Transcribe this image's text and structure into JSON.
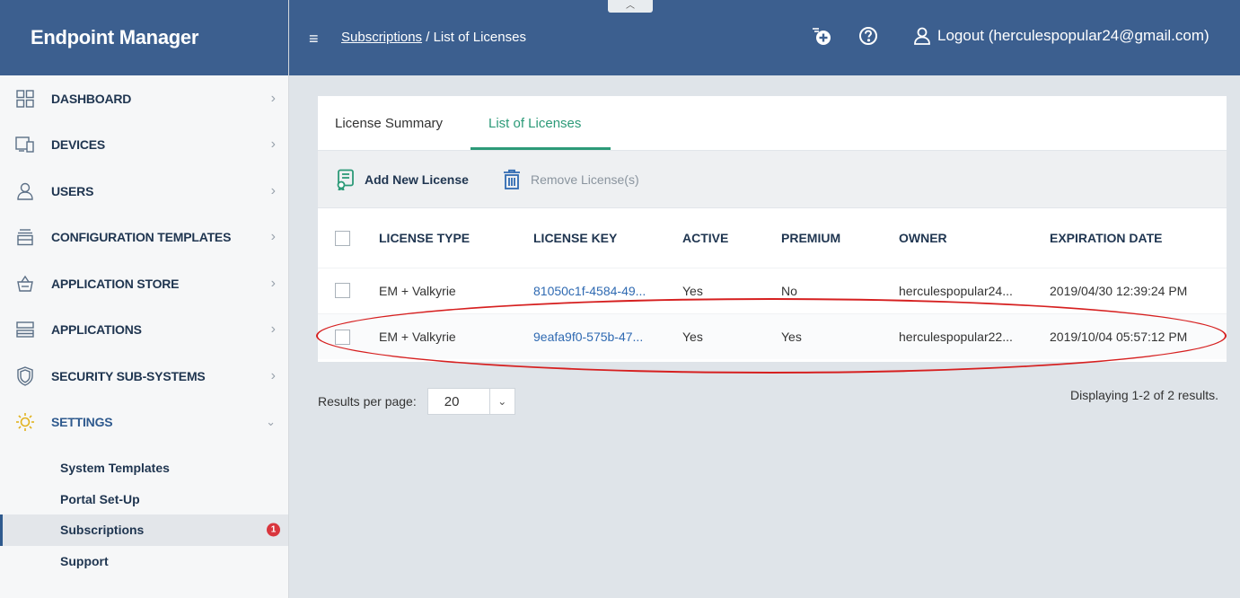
{
  "app": {
    "title": "Endpoint Manager"
  },
  "sidebar": {
    "items": [
      {
        "label": "DASHBOARD",
        "icon": "dashboard-icon"
      },
      {
        "label": "DEVICES",
        "icon": "devices-icon"
      },
      {
        "label": "USERS",
        "icon": "user-icon"
      },
      {
        "label": "CONFIGURATION TEMPLATES",
        "icon": "templates-icon"
      },
      {
        "label": "APPLICATION STORE",
        "icon": "store-basket-icon"
      },
      {
        "label": "APPLICATIONS",
        "icon": "applications-icon"
      },
      {
        "label": "SECURITY SUB-SYSTEMS",
        "icon": "shield-icon"
      },
      {
        "label": "SETTINGS",
        "icon": "gear-icon"
      }
    ],
    "settings_sub": [
      {
        "label": "System Templates"
      },
      {
        "label": "Portal Set-Up"
      },
      {
        "label": "Subscriptions",
        "badge": "1"
      },
      {
        "label": "Support"
      }
    ]
  },
  "header": {
    "breadcrumb_link": "Subscriptions",
    "breadcrumb_sep": " / ",
    "breadcrumb_current": "List of Licenses",
    "logout_label": "Logout (herculespopular24@gmail.com)"
  },
  "tabs": [
    "License Summary",
    "List of Licenses"
  ],
  "toolbar": {
    "add_label": "Add New License",
    "remove_label": "Remove License(s)"
  },
  "table": {
    "headers": [
      "LICENSE TYPE",
      "LICENSE KEY",
      "ACTIVE",
      "PREMIUM",
      "OWNER",
      "EXPIRATION DATE"
    ],
    "rows": [
      [
        "EM + Valkyrie",
        "81050c1f-4584-49...",
        "Yes",
        "No",
        "herculespopular24...",
        "2019/04/30 12:39:24 PM"
      ],
      [
        "EM + Valkyrie",
        "9eafa9f0-575b-47...",
        "Yes",
        "Yes",
        "herculespopular22...",
        "2019/10/04 05:57:12 PM"
      ]
    ]
  },
  "pagination": {
    "results_label": "Results per page:",
    "per_page": "20",
    "summary": "Displaying 1-2 of 2 results."
  },
  "colors": {
    "header": "#3c5f8f",
    "accent": "#2c9a78",
    "link": "#2f6ab2",
    "highlight": "#d62020",
    "badge": "#d9363e"
  }
}
